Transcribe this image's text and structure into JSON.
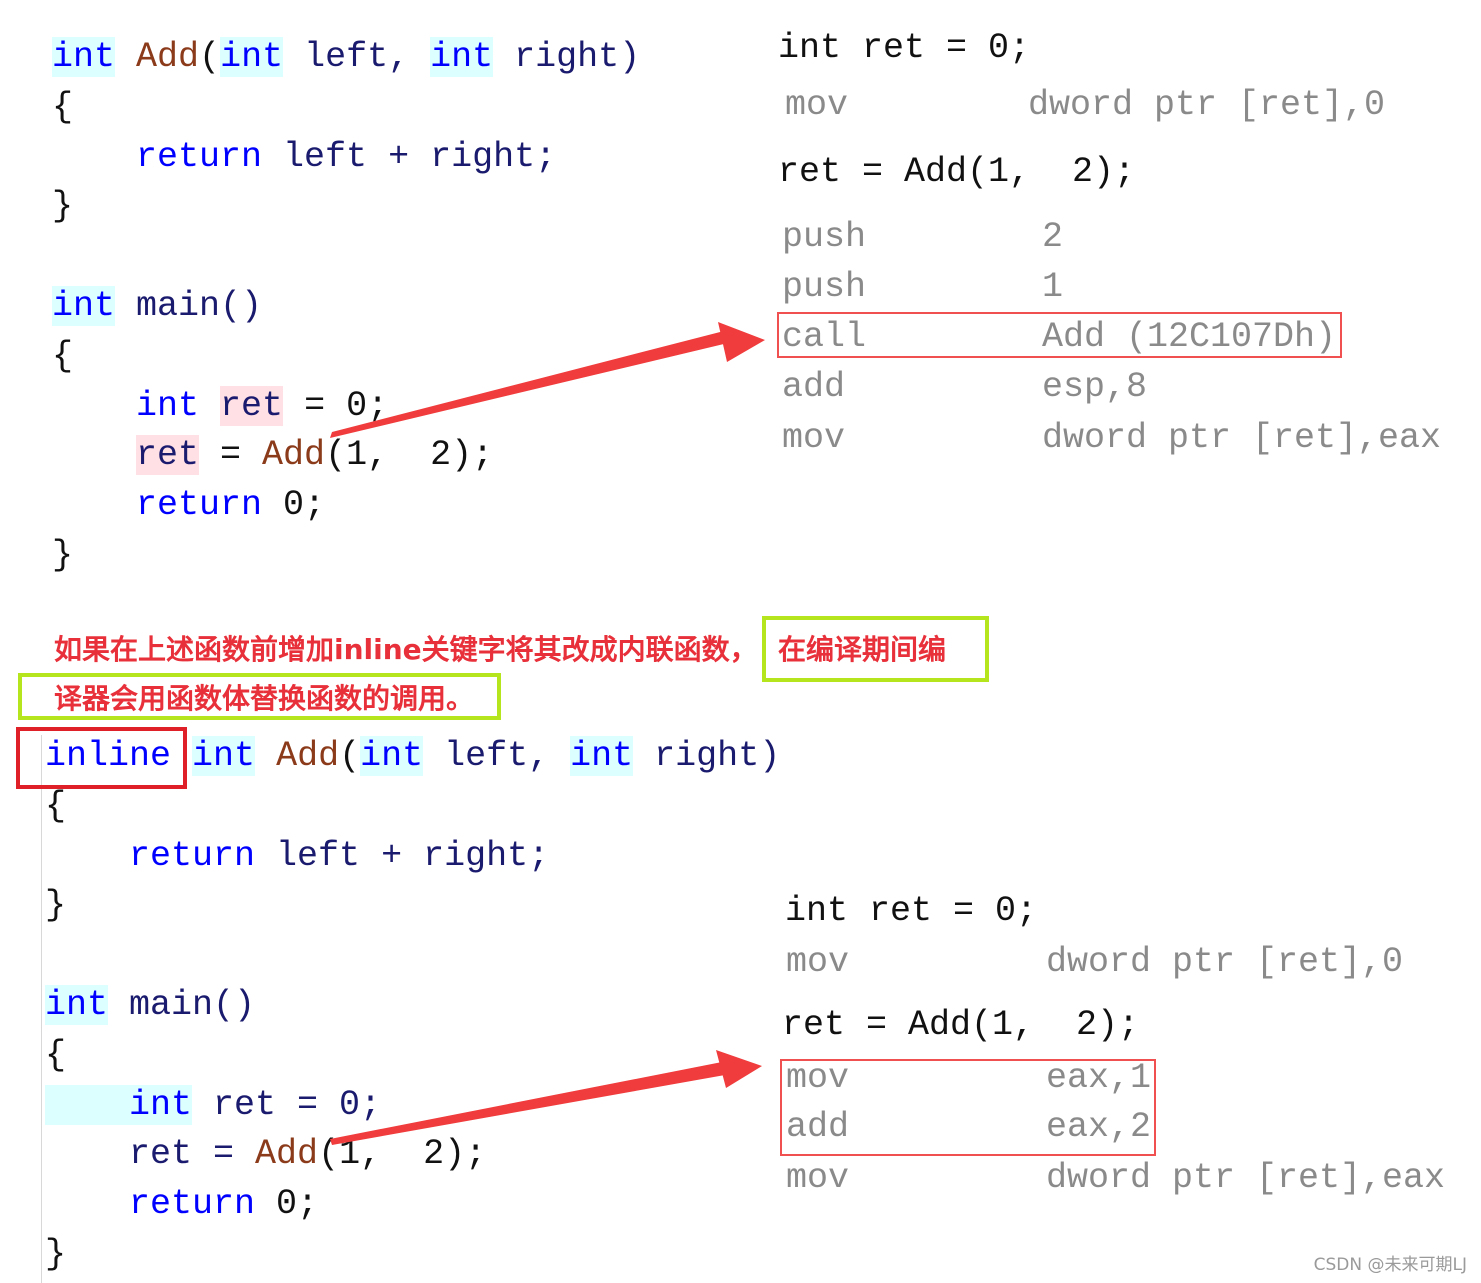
{
  "top": {
    "code": [
      [
        {
          "t": "int",
          "c": "k hc"
        },
        {
          "t": " ",
          "c": "p"
        },
        {
          "t": "Add",
          "c": "f"
        },
        {
          "t": "(",
          "c": "p"
        },
        {
          "t": "int",
          "c": "k hc"
        },
        {
          "t": " left, ",
          "c": "i"
        },
        {
          "t": "int",
          "c": "k hc"
        },
        {
          "t": " right)",
          "c": "i"
        }
      ],
      [
        {
          "t": "{",
          "c": "p"
        }
      ],
      [
        {
          "t": "    return",
          "c": "k"
        },
        {
          "t": " left + right;",
          "c": "i"
        }
      ],
      [
        {
          "t": "}",
          "c": "p"
        }
      ],
      [],
      [
        {
          "t": "int",
          "c": "k hc"
        },
        {
          "t": " main()",
          "c": "i"
        }
      ],
      [
        {
          "t": "{",
          "c": "p"
        }
      ],
      [
        {
          "t": "    int",
          "c": "k"
        },
        {
          "t": " ",
          "c": "p"
        },
        {
          "t": "ret",
          "c": "i hp"
        },
        {
          "t": " = 0;",
          "c": "p"
        }
      ],
      [
        {
          "t": "    ",
          "c": "p"
        },
        {
          "t": "ret",
          "c": "i hp"
        },
        {
          "t": " = ",
          "c": "p"
        },
        {
          "t": "Add",
          "c": "f"
        },
        {
          "t": "(1,  2);",
          "c": "p"
        }
      ],
      [
        {
          "t": "    return",
          "c": "k"
        },
        {
          "t": " 0;",
          "c": "p"
        }
      ],
      [
        {
          "t": "}",
          "c": "p"
        }
      ]
    ],
    "asm": {
      "src1": "int ret = 0;",
      "mov1_op": "mov",
      "mov1_arg": "dword ptr [ret],0",
      "src2": "ret = Add(1,  2);",
      "rows": [
        {
          "op": "push",
          "arg": "2"
        },
        {
          "op": "push",
          "arg": "1"
        },
        {
          "op": "call",
          "arg": "Add (12C107Dh)"
        },
        {
          "op": "add",
          "arg": "esp,8"
        },
        {
          "op": "mov",
          "arg": "dword ptr [ret],eax"
        }
      ]
    }
  },
  "note": {
    "line1a": "如果在上述函数前增加inline关键字将其改成内联函数，",
    "line1b": "在编译期间编",
    "line2": "译器会用函数体替换函数的调用。"
  },
  "bottom": {
    "code": [
      [
        {
          "t": "inline",
          "c": "k"
        },
        {
          "t": " ",
          "c": "p"
        },
        {
          "t": "int",
          "c": "k hc"
        },
        {
          "t": " ",
          "c": "p"
        },
        {
          "t": "Add",
          "c": "f"
        },
        {
          "t": "(",
          "c": "p"
        },
        {
          "t": "int",
          "c": "k hc"
        },
        {
          "t": " left, ",
          "c": "i"
        },
        {
          "t": "int",
          "c": "k hc"
        },
        {
          "t": " right)",
          "c": "i"
        }
      ],
      [
        {
          "t": "{",
          "c": "p"
        }
      ],
      [
        {
          "t": "    return",
          "c": "k"
        },
        {
          "t": " left + right;",
          "c": "i"
        }
      ],
      [
        {
          "t": "}",
          "c": "p"
        }
      ],
      [],
      [
        {
          "t": "int",
          "c": "k hc"
        },
        {
          "t": " main()",
          "c": "i"
        }
      ],
      [
        {
          "t": "{",
          "c": "p"
        }
      ],
      [
        {
          "t": "    int",
          "c": "k hc"
        },
        {
          "t": " ret = 0;",
          "c": "i"
        }
      ],
      [
        {
          "t": "    ret = ",
          "c": "i"
        },
        {
          "t": "Add",
          "c": "f"
        },
        {
          "t": "(1,  2);",
          "c": "p"
        }
      ],
      [
        {
          "t": "    return",
          "c": "k"
        },
        {
          "t": " 0;",
          "c": "p"
        }
      ],
      [
        {
          "t": "}",
          "c": "p"
        }
      ]
    ],
    "asm": {
      "src1": "int ret = 0;",
      "mov1_op": "mov",
      "mov1_arg": "dword ptr [ret],0",
      "src2": "ret = Add(1,  2);",
      "rows": [
        {
          "op": "mov",
          "arg": "eax,1"
        },
        {
          "op": "add",
          "arg": "eax,2"
        },
        {
          "op": "mov",
          "arg": "dword ptr [ret],eax"
        }
      ]
    }
  },
  "watermark": "CSDN @未来可期LJ",
  "colors": {
    "keyword": "#0000ff",
    "function": "#8b3a1a",
    "annotation_red": "#e8303a",
    "highlight_green": "#b5e61d",
    "arrow": "#f03c3c",
    "asm_gray": "#8a8a8a"
  }
}
